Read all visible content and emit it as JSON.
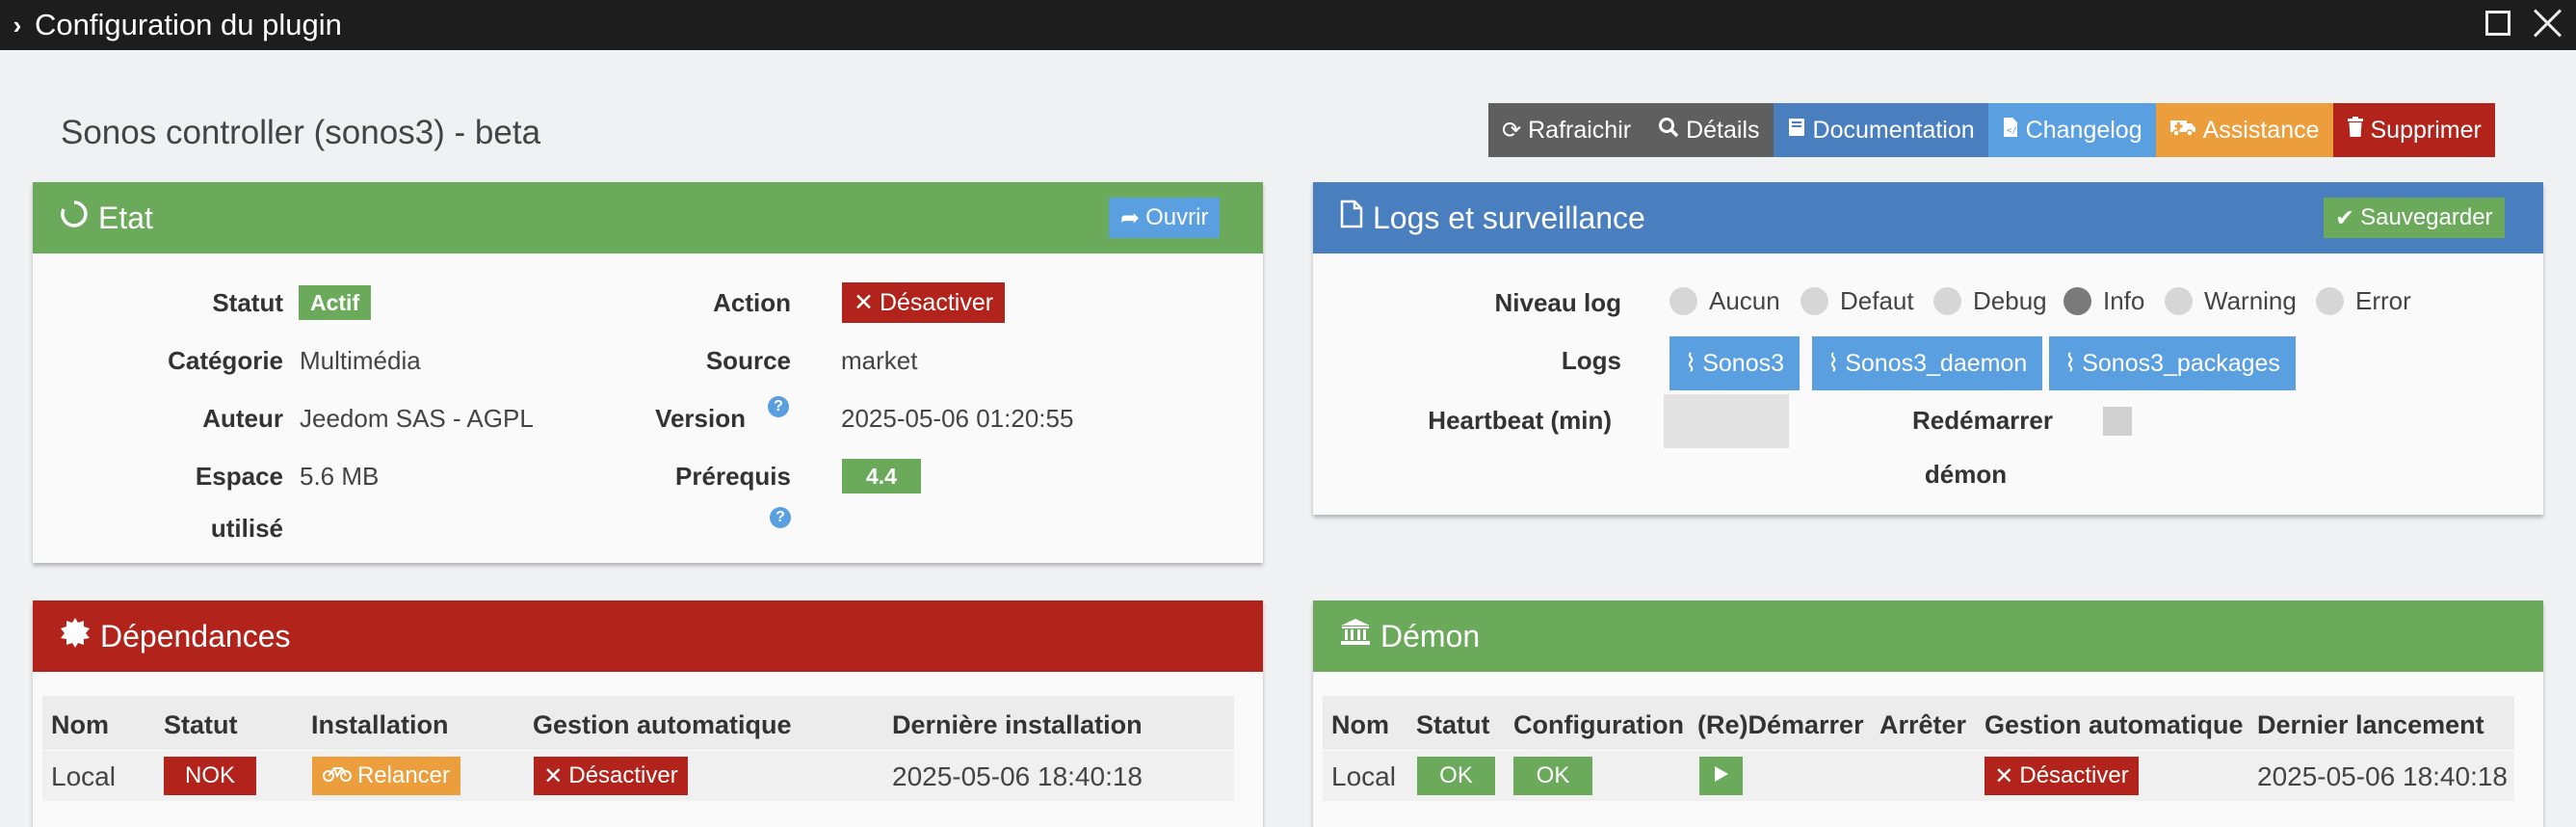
{
  "window": {
    "title": "Configuration du plugin"
  },
  "plugin": {
    "title": "Sonos controller (sonos3) - beta"
  },
  "toolbar": {
    "refresh": "Rafraichir",
    "details": "Détails",
    "documentation": "Documentation",
    "changelog": "Changelog",
    "assistance": "Assistance",
    "delete": "Supprimer"
  },
  "etat": {
    "title": "Etat",
    "open_button": "Ouvrir",
    "statut_label": "Statut",
    "statut_value": "Actif",
    "action_label": "Action",
    "action_button": "Désactiver",
    "categorie_label": "Catégorie",
    "categorie_value": "Multimédia",
    "source_label": "Source",
    "source_value": "market",
    "auteur_label": "Auteur",
    "auteur_value": "Jeedom SAS - AGPL",
    "version_label": "Version",
    "version_value": "2025-05-06 01:20:55",
    "espace_label_1": "Espace",
    "espace_label_2": "utilisé",
    "espace_value": "5.6 MB",
    "prerequis_label": "Prérequis",
    "prerequis_value": "4.4"
  },
  "logs": {
    "title": "Logs et surveillance",
    "save_button": "Sauvegarder",
    "niveau_label": "Niveau log",
    "levels": [
      "Aucun",
      "Defaut",
      "Debug",
      "Info",
      "Warning",
      "Error"
    ],
    "selected_level": "Info",
    "logs_label": "Logs",
    "log_files": [
      "Sonos3",
      "Sonos3_daemon",
      "Sonos3_packages"
    ],
    "heartbeat_label": "Heartbeat (min)",
    "heartbeat_value": "",
    "restart_label_1": "Redémarrer",
    "restart_label_2": "démon"
  },
  "dependances": {
    "title": "Dépendances",
    "headers": {
      "nom": "Nom",
      "statut": "Statut",
      "installation": "Installation",
      "gestion": "Gestion automatique",
      "derniere": "Dernière installation"
    },
    "row": {
      "nom": "Local",
      "statut": "NOK",
      "installation": "Relancer",
      "gestion": "Désactiver",
      "derniere": "2025-05-06 18:40:18"
    }
  },
  "demon": {
    "title": "Démon",
    "headers": {
      "nom": "Nom",
      "statut": "Statut",
      "configuration": "Configuration",
      "redemarrer": "(Re)Démarrer",
      "arreter": "Arrêter",
      "gestion": "Gestion automatique",
      "dernier": "Dernier lancement"
    },
    "row": {
      "nom": "Local",
      "statut": "OK",
      "configuration": "OK",
      "gestion": "Désactiver",
      "dernier": "2025-05-06 18:40:18"
    }
  },
  "icons": {
    "refresh": "refresh-icon",
    "details": "search-icon",
    "documentation": "book-icon",
    "changelog": "file-code-icon",
    "assistance": "ambulance-icon",
    "delete": "trash-icon",
    "etat": "circle-notch-icon",
    "open": "share-icon",
    "logs": "file-icon",
    "save": "check-circle-icon",
    "log_file": "paperclip-icon",
    "dependances": "certificate-icon",
    "demon": "university-icon",
    "relancer": "bicycle-icon",
    "play": "play-icon",
    "close": "times-icon"
  },
  "colors": {
    "green": "#6aaa5a",
    "red": "#b2241b",
    "blue": "#4a7fbf",
    "light_blue": "#5a9fe0",
    "orange": "#ec9e3c",
    "gray": "#5f5f5f",
    "titlebar": "#1d1d1d"
  }
}
